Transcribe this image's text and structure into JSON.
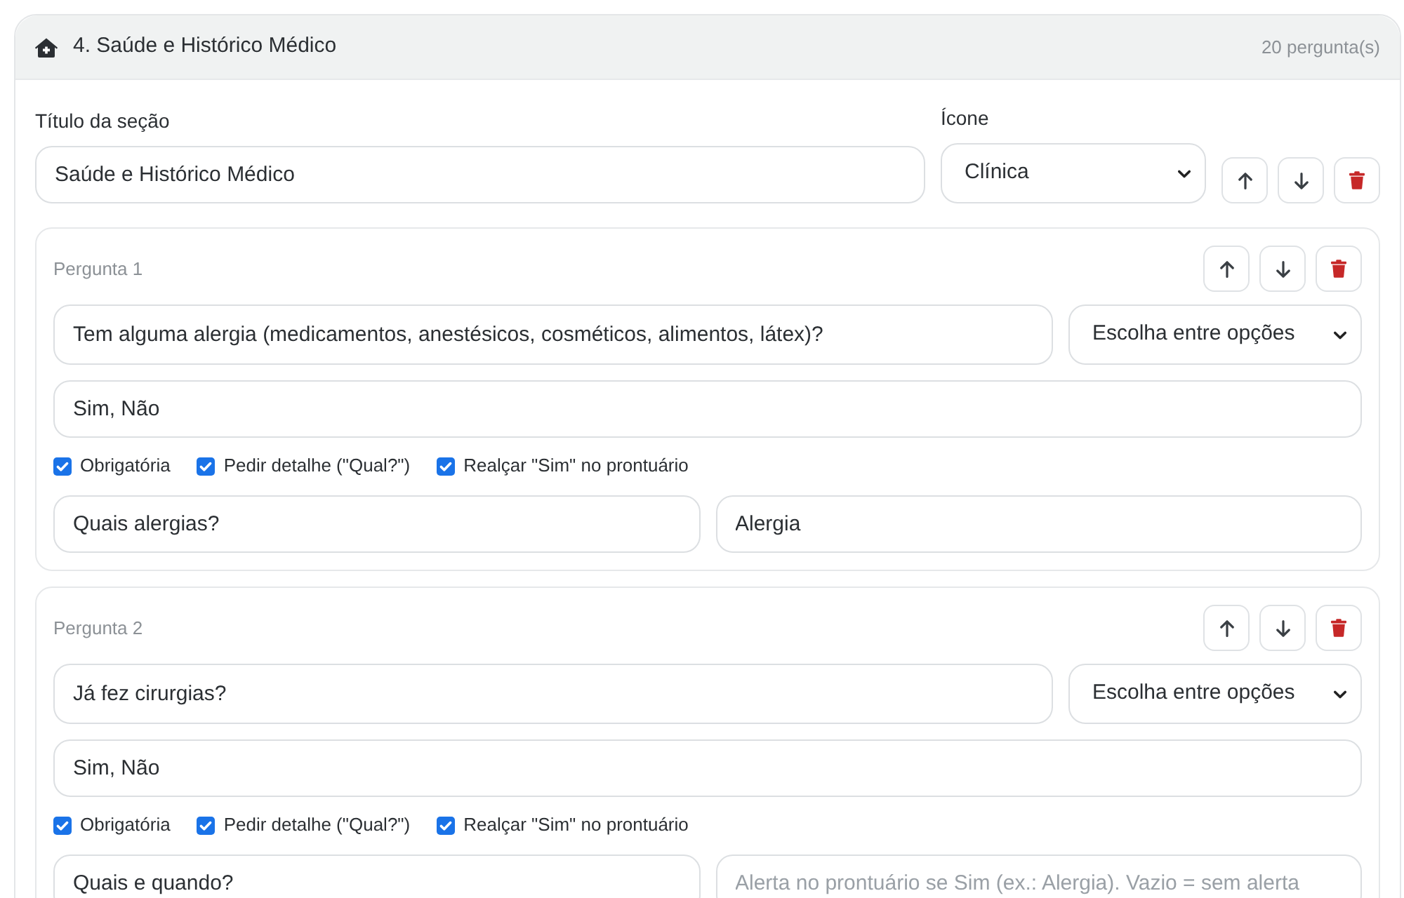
{
  "section": {
    "title": "4. Saúde e Histórico Médico",
    "count": "20 pergunta(s)"
  },
  "section_title_field": {
    "label": "Título da seção",
    "value": "Saúde e Histórico Médico"
  },
  "icon_select": {
    "label": "Ícone",
    "value": "Clínica"
  },
  "questions": [
    {
      "label": "Pergunta 1",
      "question": {
        "value": "Tem alguma alergia (medicamentos, anestésicos, cosméticos, alimentos, látex)?"
      },
      "type": "Escolha entre opções",
      "options": {
        "value": "Sim, Não"
      },
      "flags": [
        {
          "label": "Obrigatória",
          "checked": true
        },
        {
          "label": "Pedir detalhe (\"Qual?\")",
          "checked": true
        },
        {
          "label": "Realçar \"Sim\" no prontuário",
          "checked": true
        }
      ],
      "detail_prompt": {
        "value": "Quais alergias?"
      },
      "alert": {
        "value": "Alergia"
      }
    },
    {
      "label": "Pergunta 2",
      "question": {
        "value": "Já fez cirurgias?"
      },
      "type": "Escolha entre opções",
      "options": {
        "value": "Sim, Não"
      },
      "flags": [
        {
          "label": "Obrigatória",
          "checked": true
        },
        {
          "label": "Pedir detalhe (\"Qual?\")",
          "checked": true
        },
        {
          "label": "Realçar \"Sim\" no prontuário",
          "checked": true
        }
      ],
      "detail_prompt": {
        "value": "Quais e quando?"
      },
      "alert": {
        "placeholder": "Alerta no prontuário se Sim (ex.: Alergia). Vazio = sem alerta"
      }
    }
  ]
}
